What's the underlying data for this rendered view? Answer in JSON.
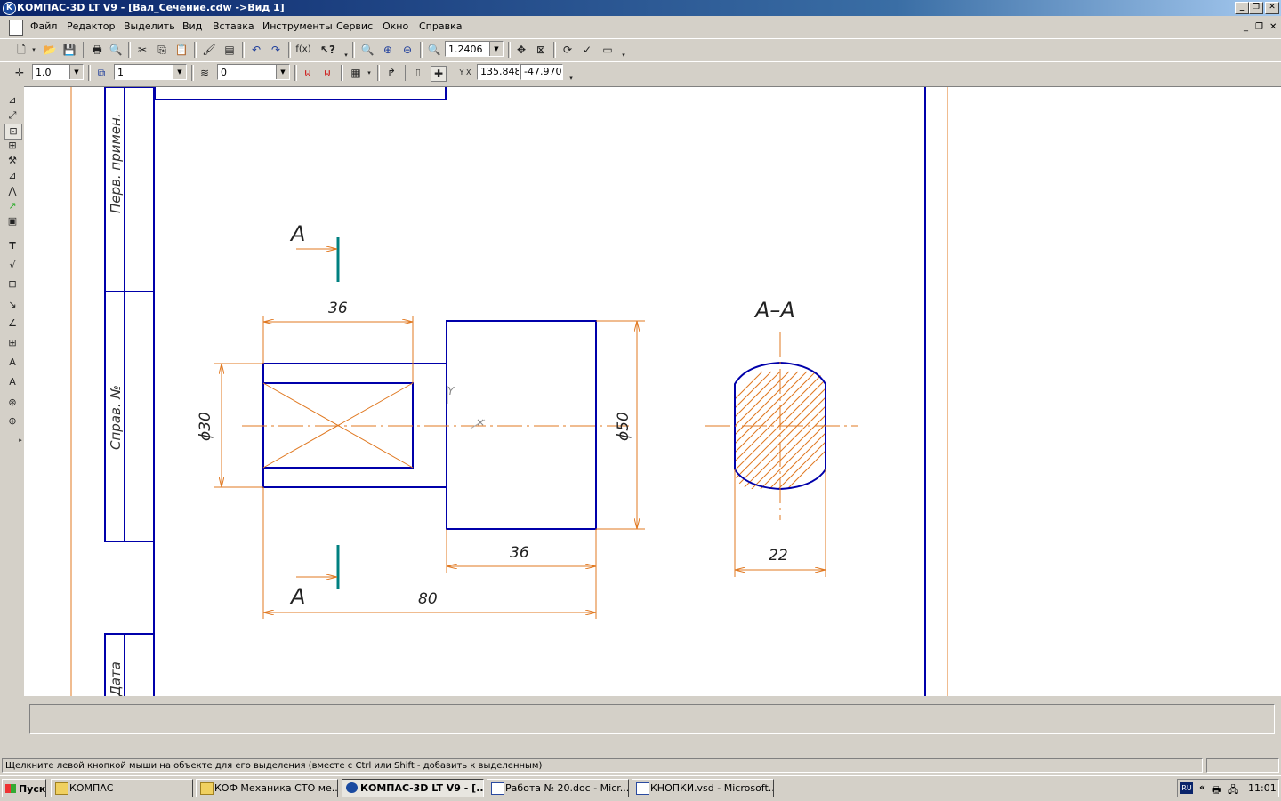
{
  "window": {
    "title": "КОМПАС-3D LT V9 - [Вал_Сечение.cdw ->Вид 1]",
    "app_icon_letter": "K"
  },
  "menu": {
    "items": [
      "Файл",
      "Редактор",
      "Выделить",
      "Вид",
      "Вставка",
      "Инструменты",
      "Сервис",
      "Окно",
      "Справка"
    ]
  },
  "toolbar": {
    "zoom": "1.2406",
    "step": "1.0",
    "layer": "1",
    "style": "0",
    "coord_x": "135.848",
    "coord_y": "-47.970",
    "coord_label": "Y X",
    "fx_label": "f(x)"
  },
  "drawing": {
    "stamp_labels": [
      "Перв. примен.",
      "Справ. №",
      "Дата"
    ],
    "section_letter_top": "A",
    "section_letter_bottom": "A",
    "section_title": "A–A",
    "dim_36_left": "36",
    "dim_36_right": "36",
    "dim_80": "80",
    "dim_d30": "ϕ30",
    "dim_d50": "ϕ50",
    "dim_22": "22",
    "origin_y_label": "Y",
    "colors": {
      "main_line": "#0000aa",
      "dimension": "#e07820",
      "cut_marker": "#008080",
      "hatch": "#e07820"
    }
  },
  "status": {
    "message": "Щелкните левой кнопкой мыши на объекте для его выделения (вместе с Ctrl или Shift - добавить к выделенным)"
  },
  "taskbar": {
    "start": "Пуск",
    "tasks": [
      {
        "label": "КОМПАС",
        "active": false
      },
      {
        "label": "КОФ Механика СТО ме...",
        "active": false
      },
      {
        "label": "КОМПАС-3D LT V9 - [...",
        "active": true
      },
      {
        "label": "Работа № 20.doc - Micr...",
        "active": false
      },
      {
        "label": "КНОПКИ.vsd - Microsoft...",
        "active": false
      }
    ],
    "lang": "RU",
    "time": "11:01"
  }
}
